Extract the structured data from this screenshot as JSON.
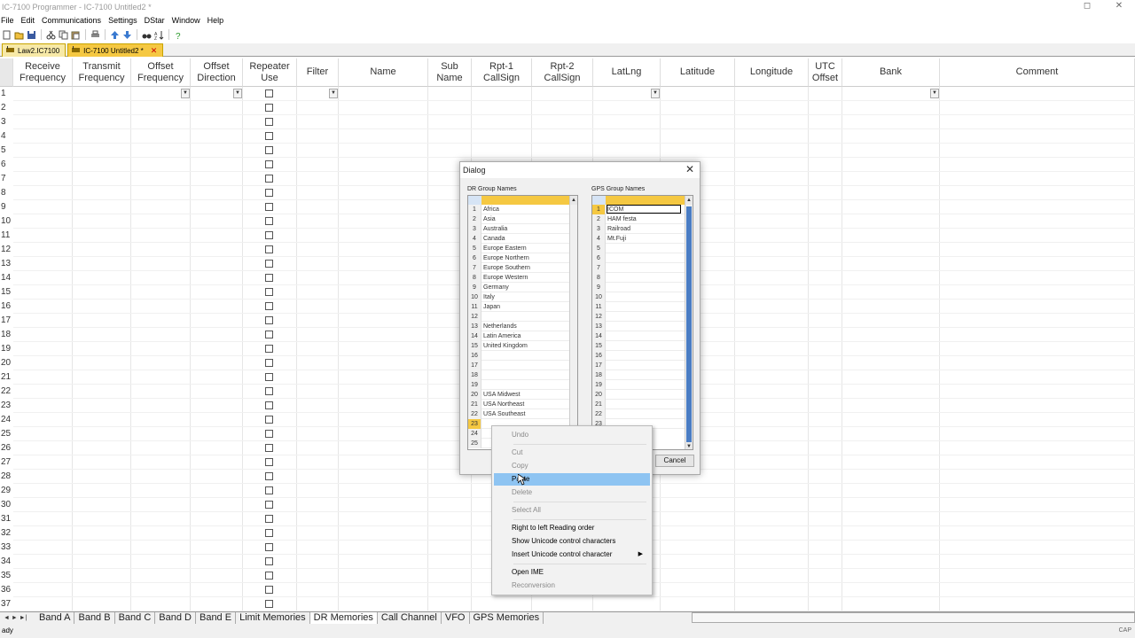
{
  "window": {
    "title": "IC-7100 Programmer - IC-7100 Untitled2 *"
  },
  "menu": [
    "File",
    "Edit",
    "Communications",
    "Settings",
    "DStar",
    "Window",
    "Help"
  ],
  "toolbar_icons": [
    "new-icon",
    "open-icon",
    "save-icon",
    "cut-icon",
    "copy-icon",
    "paste-icon",
    "print-icon",
    "move-up-icon",
    "move-down-icon",
    "find-icon",
    "sort-icon",
    "help-icon"
  ],
  "file_tabs": [
    {
      "label": "Law2.IC7100",
      "active": false
    },
    {
      "label": "IC-7100 Untitled2 *",
      "active": true
    }
  ],
  "columns": [
    {
      "label": "Receive\nFrequency"
    },
    {
      "label": "Transmit\nFrequency"
    },
    {
      "label": "Offset\nFrequency"
    },
    {
      "label": "Offset\nDirection"
    },
    {
      "label": "Repeater\nUse"
    },
    {
      "label": "Filter"
    },
    {
      "label": "Name"
    },
    {
      "label": "Sub\nName"
    },
    {
      "label": "Rpt-1\nCallSign"
    },
    {
      "label": "Rpt-2\nCallSign"
    },
    {
      "label": "LatLng"
    },
    {
      "label": "Latitude"
    },
    {
      "label": "Longitude"
    },
    {
      "label": "UTC\nOffset"
    },
    {
      "label": "Bank"
    },
    {
      "label": "Comment"
    }
  ],
  "row_numbers": [
    "1",
    "2",
    "3",
    "4",
    "5",
    "6",
    "7",
    "8",
    "9",
    "10",
    "11",
    "12",
    "13",
    "14",
    "15",
    "16",
    "17",
    "18",
    "19",
    "20",
    "21",
    "22",
    "23",
    "24",
    "25",
    "26",
    "27",
    "28",
    "29",
    "30",
    "31",
    "32",
    "33",
    "34",
    "35",
    "36",
    "37"
  ],
  "sheet_tabs": [
    "Band A",
    "Band B",
    "Band C",
    "Band D",
    "Band E",
    "Limit Memories",
    "DR Memories",
    "Call Channel",
    "VFO",
    "GPS Memories"
  ],
  "active_sheet": "DR Memories",
  "status": {
    "text": "ady",
    "caps": "CAP"
  },
  "dialog": {
    "title": "Dialog",
    "dr_label": "DR Group Names",
    "gps_label": "GPS Group Names",
    "dr_groups": [
      {
        "n": "1",
        "name": "Africa"
      },
      {
        "n": "2",
        "name": "Asia"
      },
      {
        "n": "3",
        "name": "Australia"
      },
      {
        "n": "4",
        "name": "Canada"
      },
      {
        "n": "5",
        "name": "Europe Eastern"
      },
      {
        "n": "6",
        "name": "Europe Northern"
      },
      {
        "n": "7",
        "name": "Europe Southern"
      },
      {
        "n": "8",
        "name": "Europe Western"
      },
      {
        "n": "9",
        "name": "Germany"
      },
      {
        "n": "10",
        "name": "Italy"
      },
      {
        "n": "11",
        "name": "Japan"
      },
      {
        "n": "12",
        "name": ""
      },
      {
        "n": "13",
        "name": "Netherlands"
      },
      {
        "n": "14",
        "name": "Latin America"
      },
      {
        "n": "15",
        "name": "United Kingdom"
      },
      {
        "n": "16",
        "name": ""
      },
      {
        "n": "17",
        "name": ""
      },
      {
        "n": "18",
        "name": ""
      },
      {
        "n": "19",
        "name": ""
      },
      {
        "n": "20",
        "name": "USA Midwest"
      },
      {
        "n": "21",
        "name": "USA Northeast"
      },
      {
        "n": "22",
        "name": "USA Southeast"
      },
      {
        "n": "23",
        "name": ""
      },
      {
        "n": "24",
        "name": ""
      },
      {
        "n": "25",
        "name": ""
      }
    ],
    "gps_groups": [
      {
        "n": "1",
        "name": "ICOM"
      },
      {
        "n": "2",
        "name": "HAM festa"
      },
      {
        "n": "3",
        "name": "Railroad"
      },
      {
        "n": "4",
        "name": "Mt.Fuji"
      },
      {
        "n": "5",
        "name": ""
      },
      {
        "n": "6",
        "name": ""
      },
      {
        "n": "7",
        "name": ""
      },
      {
        "n": "8",
        "name": ""
      },
      {
        "n": "9",
        "name": ""
      },
      {
        "n": "10",
        "name": ""
      },
      {
        "n": "11",
        "name": ""
      },
      {
        "n": "12",
        "name": ""
      },
      {
        "n": "13",
        "name": ""
      },
      {
        "n": "14",
        "name": ""
      },
      {
        "n": "15",
        "name": ""
      },
      {
        "n": "16",
        "name": ""
      },
      {
        "n": "17",
        "name": ""
      },
      {
        "n": "18",
        "name": ""
      },
      {
        "n": "19",
        "name": ""
      },
      {
        "n": "20",
        "name": ""
      },
      {
        "n": "21",
        "name": ""
      },
      {
        "n": "22",
        "name": ""
      },
      {
        "n": "23",
        "name": ""
      }
    ],
    "cancel_label": "Cancel"
  },
  "context_menu": {
    "undo": "Undo",
    "cut": "Cut",
    "copy": "Copy",
    "paste": "Paste",
    "delete": "Delete",
    "select_all": "Select All",
    "rtl": "Right to left Reading order",
    "show_unicode": "Show Unicode control characters",
    "insert_unicode": "Insert Unicode control character",
    "open_ime": "Open IME",
    "reconversion": "Reconversion"
  },
  "colors": {
    "tab_active": "#f5c842",
    "selection": "#8ec4f2",
    "scroll_thumb": "#4a7dc4"
  }
}
